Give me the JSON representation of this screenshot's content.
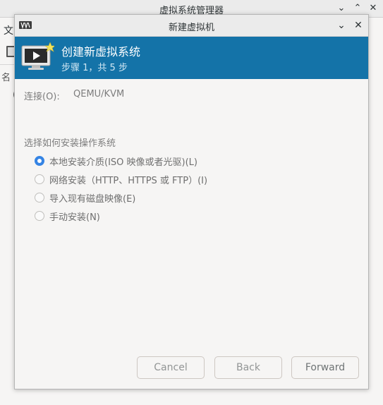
{
  "main_window": {
    "title": "虚拟系统管理器",
    "menu_first": "文",
    "name_col": "名",
    "row_char": "("
  },
  "dialog": {
    "title": "新建虚拟机",
    "banner": {
      "title": "创建新虚拟系统",
      "step": "步骤 1，共 5 步"
    },
    "connection_label": "连接(O):",
    "connection_value": "QEMU/KVM",
    "install_section_label": "选择如何安装操作系统",
    "install_options": [
      {
        "label": "本地安装介质(ISO 映像或者光驱)(L)",
        "checked": true
      },
      {
        "label": "网络安装（HTTP、HTTPS 或 FTP）(I)",
        "checked": false
      },
      {
        "label": "导入现有磁盘映像(E)",
        "checked": false
      },
      {
        "label": "手动安装(N)",
        "checked": false
      }
    ],
    "buttons": {
      "cancel": "Cancel",
      "back": "Back",
      "forward": "Forward"
    }
  },
  "colors": {
    "banner": "#1473a8",
    "radio_checked": "#3584e4"
  }
}
